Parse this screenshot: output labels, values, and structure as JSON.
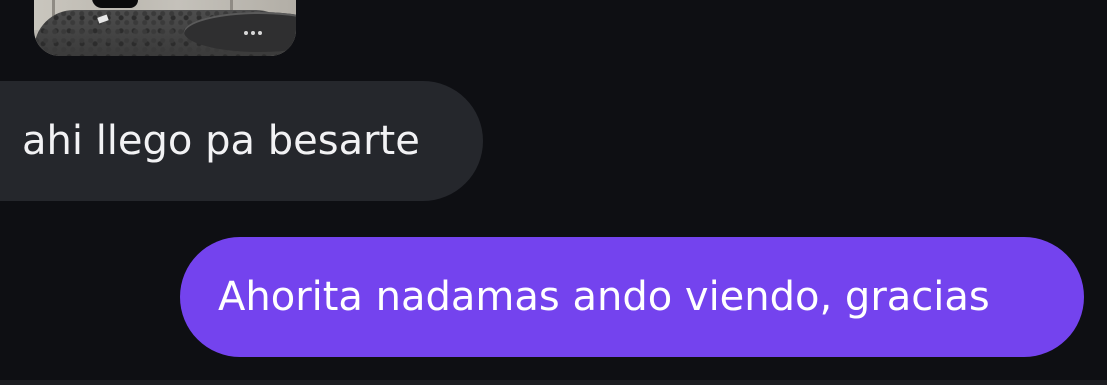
{
  "conversation": {
    "messages": [
      {
        "direction": "incoming",
        "type": "photo"
      },
      {
        "direction": "incoming",
        "type": "text",
        "text": "ahi llego pa besarte"
      },
      {
        "direction": "outgoing",
        "type": "text",
        "text": "Ahorita nadamas ando viendo, gracias"
      }
    ]
  },
  "colors": {
    "background": "#0e0f13",
    "incoming_bubble": "#25272c",
    "outgoing_bubble": "#7443ee",
    "incoming_text": "#f2f2f4",
    "outgoing_text": "#ffffff"
  }
}
